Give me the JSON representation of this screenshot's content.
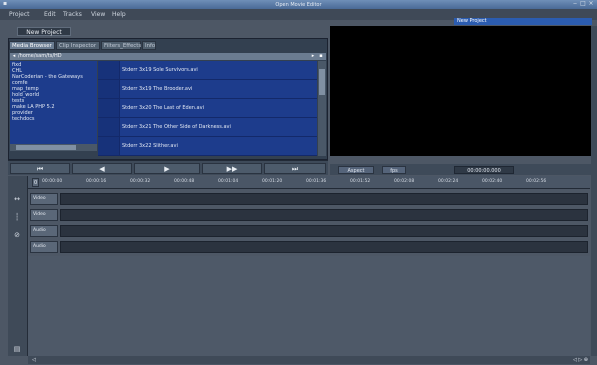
{
  "window": {
    "title": "Open Movie Editor",
    "controls": [
      "‒",
      "□",
      "×"
    ]
  },
  "menu": {
    "items": [
      "Project",
      "Edit",
      "Tracks",
      "View",
      "Help"
    ]
  },
  "project": {
    "name": "New Project"
  },
  "browser": {
    "tabs": [
      "Media Browser",
      "Clip Inspector",
      "Filters_Effects",
      "Info"
    ],
    "path": "/home/sam/ts/HD",
    "folders": [
      "fixd",
      "CHL",
      "NarCoderian - the Gateways",
      "comfe",
      "map_temp",
      "hold_world",
      "tests",
      "make LA PHP 5.2",
      "provider",
      "techdocs"
    ],
    "files": [
      "Stderr 3x19 Sole Survivors.avi",
      "Stderr 3x19 The Brooder.avi",
      "Stderr 3x20 The Last of Eden.avi",
      "Stderr 3x21 The Other Side of Darkness.avi",
      "Stderr 3x22 Slither.avi"
    ]
  },
  "monitor": {
    "title": "New Project",
    "aspect_label": "Aspect",
    "fps_label": "fps",
    "timecode": "00:00:00.000"
  },
  "transport": {
    "buttons": [
      "⏮",
      "◀",
      "▶",
      "▶▶",
      "⏭"
    ]
  },
  "timeline": {
    "ruler_ticks": [
      "00:00:00",
      "00:00:16",
      "00:00:32",
      "00:00:48",
      "00:01:04",
      "00:01:20",
      "00:01:36",
      "00:01:52",
      "00:02:08",
      "00:02:24",
      "00:02:40",
      "00:02:56"
    ],
    "ruler_start_btn": "0",
    "tracks": [
      "Video",
      "Video",
      "Audio",
      "Audio"
    ],
    "zoom": "◁ ▷ ⊕",
    "left_status": "◁"
  }
}
